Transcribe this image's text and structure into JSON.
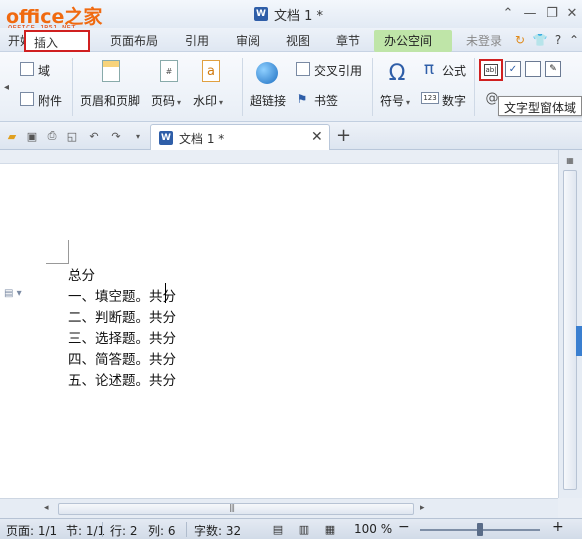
{
  "logo": {
    "text": "office之家",
    "sub": "OFFICE.JB51.NET"
  },
  "window": {
    "title": "文档 1 *",
    "minimize": "⌃",
    "maximize": "⌄",
    "close": "✕"
  },
  "menu": {
    "start": "开始",
    "insert": "插入",
    "layout": "页面布局",
    "references": "引用",
    "review": "审阅",
    "view": "视图",
    "section": "章节",
    "office_space": "办公空间",
    "login": "未登录"
  },
  "ribbon": {
    "field": "域",
    "attachment": "附件",
    "header_footer": "页眉和页脚",
    "page_number": "页码",
    "watermark": "水印",
    "hyperlink": "超链接",
    "cross_reference": "交叉引用",
    "bookmark": "书签",
    "symbol": "符号",
    "formula": "公式",
    "number": "数字",
    "tooltip": "文字型窗体域"
  },
  "tabs": {
    "doc_tab": "文档 1 *"
  },
  "document": {
    "lines": [
      "总分",
      "一、填空题。共分",
      "二、判断题。共分",
      "三、选择题。共分",
      "四、简答题。共分",
      "五、论述题。共分"
    ]
  },
  "status": {
    "page": "页面: 1/1",
    "section": "节: 1/1",
    "row": "行: 2",
    "col": "列: 6",
    "words": "字数: 32",
    "zoom": "100 %",
    "zoom_level": 0.5
  },
  "colors": {
    "accent": "#d02020",
    "office_green": "#bfe5a8",
    "logo_orange": "#f06a10"
  }
}
